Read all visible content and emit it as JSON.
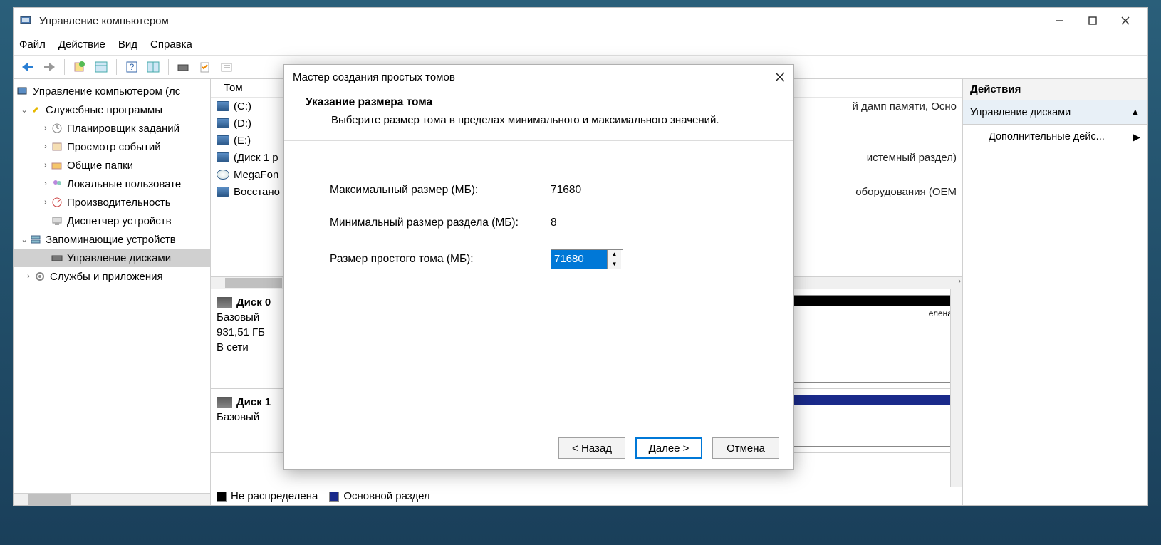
{
  "window": {
    "title": "Управление компьютером"
  },
  "menu": {
    "file": "Файл",
    "action": "Действие",
    "view": "Вид",
    "help": "Справка"
  },
  "tree": {
    "root": "Управление компьютером (лс",
    "tools": "Служебные программы",
    "scheduler": "Планировщик заданий",
    "events": "Просмотр событий",
    "shared": "Общие папки",
    "users": "Локальные пользовате",
    "perf": "Производительность",
    "devmgr": "Диспетчер устройств",
    "storage": "Запоминающие устройств",
    "diskmgmt": "Управление дисками",
    "services": "Службы и приложения"
  },
  "vol_header": {
    "tom": "Том"
  },
  "volumes": [
    {
      "name": "(C:)"
    },
    {
      "name": "(D:)"
    },
    {
      "name": "(E:)"
    },
    {
      "name": "(Диск 1 р"
    },
    {
      "name": "MegaFon",
      "cd": true
    },
    {
      "name": "Восстано"
    }
  ],
  "vol_tail": {
    "row0": "й дамп памяти, Осно",
    "row3": "истемный раздел)",
    "row5": "оборудования (OEM"
  },
  "disk0": {
    "label": "Диск 0",
    "type": "Базовый",
    "size": "931,51 ГБ",
    "state": "В сети",
    "segtail": "елена"
  },
  "disk1": {
    "label": "Диск 1",
    "type": "Базовый"
  },
  "legend": {
    "unalloc": "Не распределена",
    "primary": "Основной раздел"
  },
  "actions": {
    "header": "Действия",
    "main": "Управление дисками",
    "more": "Дополнительные дейс..."
  },
  "wizard": {
    "title": "Мастер создания простых томов",
    "heading": "Указание размера тома",
    "sub": "Выберите размер тома в пределах минимального и максимального значений.",
    "max_label": "Максимальный размер (МБ):",
    "max_value": "71680",
    "min_label": "Минимальный размер раздела (МБ):",
    "min_value": "8",
    "size_label": "Размер простого тома (МБ):",
    "size_value": "71680",
    "back": "< Назад",
    "next": "Далее >",
    "cancel": "Отмена"
  }
}
